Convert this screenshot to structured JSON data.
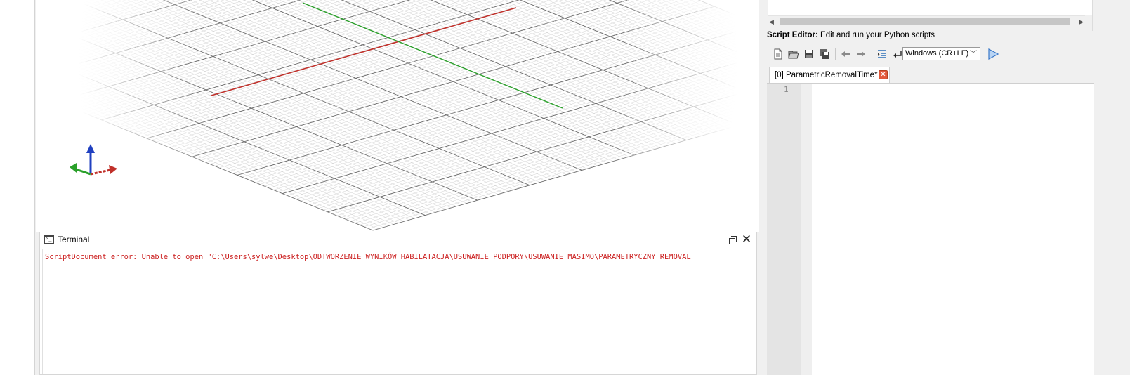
{
  "terminal": {
    "title": "Terminal",
    "error_line": "ScriptDocument error: Unable to open \"C:\\Users\\sylwe\\Desktop\\ODTWORZENIE WYNIKÓW HABILATACJA\\USUWANIE PODPORY\\USUWANIE MASIMO\\PARAMETRYCZNY REMOVAL"
  },
  "script_editor": {
    "label_bold": "Script Editor:",
    "label_rest": " Edit and run your Python scripts",
    "line_ending": "Windows (CR+LF)",
    "tab_label": "[0] ParametricRemovalTime*",
    "line_numbers": [
      "1"
    ]
  },
  "colors": {
    "x_axis": "#c0302a",
    "y_axis": "#2aa02a",
    "z_axis": "#2040c0",
    "error_text": "#cc2222",
    "tab_close": "#e2583a"
  },
  "icons": {
    "toolbar": [
      "new-file-icon",
      "open-file-icon",
      "save-icon",
      "save-all-icon",
      "undo-arrow-icon",
      "redo-arrow-icon",
      "indent-icon",
      "line-ending-icon",
      "run-icon"
    ]
  }
}
